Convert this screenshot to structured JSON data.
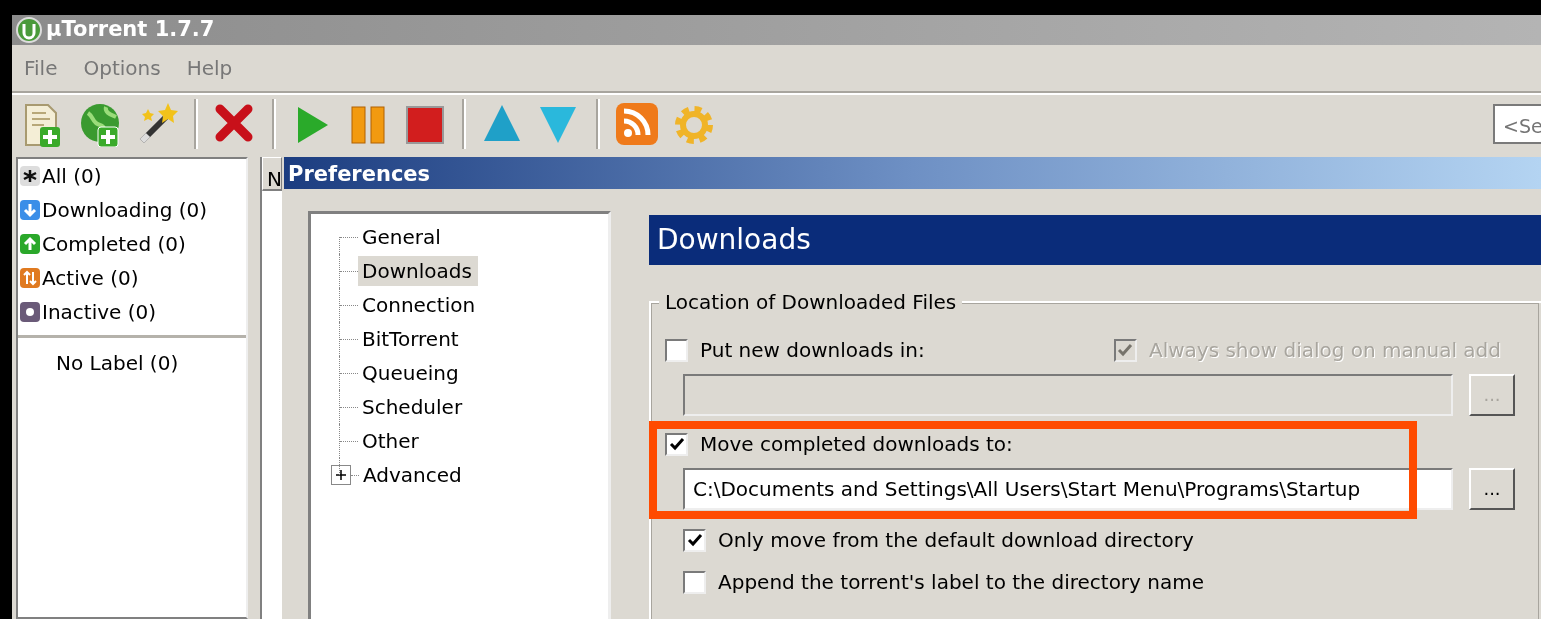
{
  "window": {
    "title": "μTorrent 1.7.7"
  },
  "menu": [
    "File",
    "Options",
    "Help"
  ],
  "search": {
    "placeholder": "<Se"
  },
  "categories": [
    {
      "label": "All (0)",
      "kind": "all"
    },
    {
      "label": "Downloading (0)",
      "kind": "downloading"
    },
    {
      "label": "Completed (0)",
      "kind": "completed"
    },
    {
      "label": "Active (0)",
      "kind": "active"
    },
    {
      "label": "Inactive (0)",
      "kind": "inactive"
    }
  ],
  "labels": [
    {
      "label": "No Label (0)"
    }
  ],
  "torrent_list": {
    "column_1": "N"
  },
  "preferences": {
    "title": "Preferences",
    "tree": [
      {
        "label": "General",
        "selected": false
      },
      {
        "label": "Downloads",
        "selected": true
      },
      {
        "label": "Connection",
        "selected": false
      },
      {
        "label": "BitTorrent",
        "selected": false
      },
      {
        "label": "Queueing",
        "selected": false
      },
      {
        "label": "Scheduler",
        "selected": false
      },
      {
        "label": "Other",
        "selected": false
      },
      {
        "label": "Advanced",
        "selected": false,
        "expanded": false
      }
    ],
    "section_title": "Downloads",
    "group": {
      "title": "Location of Downloaded Files",
      "rows": [
        {
          "kind": "checkbox",
          "label": "Put new downloads in:",
          "checked": false,
          "highlighted": false,
          "side": {
            "label": "Always show dialog on manual add",
            "checked": true,
            "disabled": true
          }
        },
        {
          "kind": "path",
          "value": "",
          "disabled": true,
          "browse": "...",
          "highlighted": false
        },
        {
          "kind": "checkbox",
          "label": "Move completed downloads to:",
          "checked": true,
          "highlighted": true
        },
        {
          "kind": "path",
          "value": "C:\\Documents and Settings\\All Users\\Start Menu\\Programs\\Startup",
          "disabled": false,
          "browse": "...",
          "highlighted": true
        },
        {
          "kind": "subcheckbox",
          "label": "Only move from the default download directory",
          "checked": true,
          "highlighted": false
        },
        {
          "kind": "subcheckbox",
          "label": "Append the torrent's label to the directory name",
          "checked": false,
          "highlighted": false
        }
      ]
    }
  }
}
